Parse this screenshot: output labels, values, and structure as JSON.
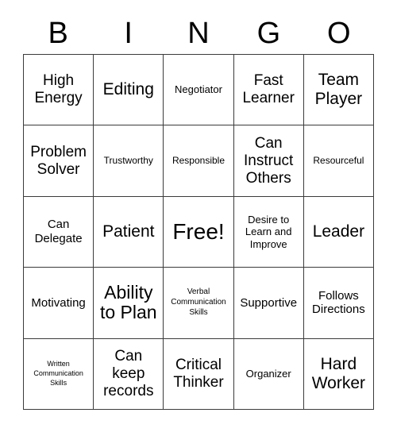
{
  "card": {
    "title": "BINGO",
    "header_letters": [
      "B",
      "I",
      "N",
      "G",
      "O"
    ],
    "border_color": "#3b3b3b",
    "background_color": "#ffffff",
    "text_color": "#000000",
    "columns": 5,
    "rows": 5,
    "free_space_index": 12
  },
  "cells": [
    {
      "text": "High Energy",
      "size": "xl",
      "free": false
    },
    {
      "text": "Editing",
      "size": "xxl",
      "free": false
    },
    {
      "text": "Negotiator",
      "size": "ml",
      "free": false
    },
    {
      "text": "Fast Learner",
      "size": "xl",
      "free": false
    },
    {
      "text": "Team Player",
      "size": "xxl",
      "free": false
    },
    {
      "text": "Problem Solver",
      "size": "xl",
      "free": false
    },
    {
      "text": "Trustworthy",
      "size": "m",
      "free": false
    },
    {
      "text": "Responsible",
      "size": "m",
      "free": false
    },
    {
      "text": "Can Instruct Others",
      "size": "xl",
      "free": false
    },
    {
      "text": "Resourceful",
      "size": "m",
      "free": false
    },
    {
      "text": "Can Delegate",
      "size": "l",
      "free": false
    },
    {
      "text": "Patient",
      "size": "xxl",
      "free": false
    },
    {
      "text": "Free!",
      "size": "free",
      "free": true
    },
    {
      "text": "Desire to Learn and Improve",
      "size": "ml",
      "free": false
    },
    {
      "text": "Leader",
      "size": "xxl",
      "free": false
    },
    {
      "text": "Motivating",
      "size": "l",
      "free": false
    },
    {
      "text": "Ability to Plan",
      "size": "h1",
      "free": false
    },
    {
      "text": "Verbal Communication Skills",
      "size": "s",
      "free": false
    },
    {
      "text": "Supportive",
      "size": "l",
      "free": false
    },
    {
      "text": "Follows Directions",
      "size": "l",
      "free": false
    },
    {
      "text": "Written Communication Skills",
      "size": "xs",
      "free": false
    },
    {
      "text": "Can keep records",
      "size": "xl",
      "free": false
    },
    {
      "text": "Critical Thinker",
      "size": "xl",
      "free": false
    },
    {
      "text": "Organizer",
      "size": "ml",
      "free": false
    },
    {
      "text": "Hard Worker",
      "size": "xxl",
      "free": false
    }
  ]
}
